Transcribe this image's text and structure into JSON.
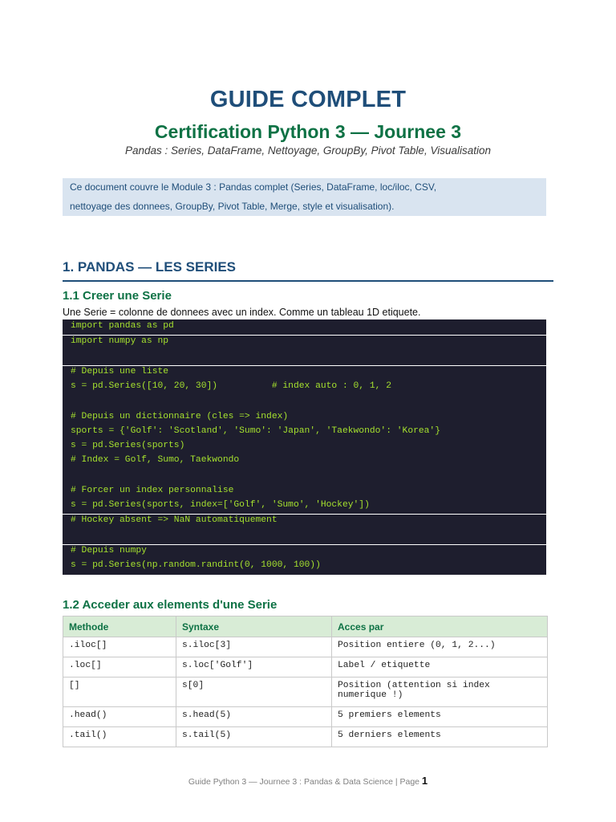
{
  "header": {
    "title": "GUIDE COMPLET",
    "subtitle": "Certification Python 3 — Journee 3",
    "tagline": "Pandas : Series, DataFrame, Nettoyage, GroupBy, Pivot Table, Visualisation"
  },
  "intro": {
    "line1": "Ce document couvre le Module 3 : Pandas complet (Series, DataFrame, loc/iloc, CSV,",
    "line2": "nettoyage des donnees, GroupBy, Pivot Table, Merge, style et visualisation)."
  },
  "section1": {
    "heading": "1.  PANDAS — LES SERIES",
    "sub1": {
      "heading": "1.1  Creer une Serie",
      "text": "Une Serie = colonne de donnees avec un index. Comme un tableau 1D etiquete.",
      "code": [
        "import pandas as pd",
        "import numpy as np",
        "# Depuis une liste",
        "s = pd.Series([10, 20, 30])          # index auto : 0, 1, 2",
        "# Depuis un dictionnaire (cles => index)",
        "sports = {'Golf': 'Scotland', 'Sumo': 'Japan', 'Taekwondo': 'Korea'}",
        "s = pd.Series(sports)",
        "# Index = Golf, Sumo, Taekwondo",
        "# Forcer un index personnalise",
        "s = pd.Series(sports, index=['Golf', 'Sumo', 'Hockey'])",
        "# Hockey absent => NaN automatiquement",
        "# Depuis numpy",
        "s = pd.Series(np.random.randint(0, 1000, 100))"
      ]
    },
    "sub2": {
      "heading": "1.2  Acceder aux elements d'une Serie",
      "columns": [
        "Methode",
        "Syntaxe",
        "Acces par"
      ],
      "rows": [
        [
          ".iloc[]",
          "s.iloc[3]",
          "Position entiere (0, 1, 2...)"
        ],
        [
          ".loc[]",
          "s.loc['Golf']",
          "Label / etiquette"
        ],
        [
          "[]",
          "s[0]",
          "Position (attention si index numerique !)"
        ],
        [
          ".head()",
          "s.head(5)",
          "5 premiers elements"
        ],
        [
          ".tail()",
          "s.tail(5)",
          "5 derniers elements"
        ]
      ]
    }
  },
  "footer": {
    "text": "Guide Python 3 — Journee 3 : Pandas & Data Science  |  Page",
    "page": "1"
  }
}
